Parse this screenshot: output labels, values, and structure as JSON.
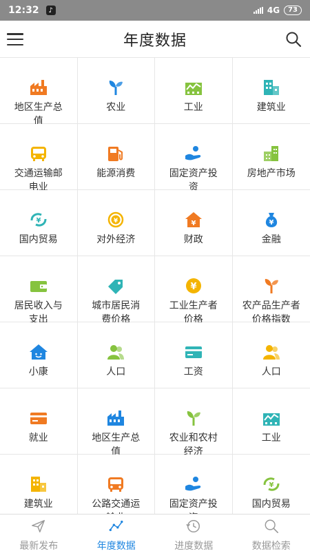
{
  "status": {
    "time": "12:32",
    "network": "4G",
    "battery": "73"
  },
  "header": {
    "title": "年度数据"
  },
  "grid": [
    [
      {
        "label": "地区生产总值",
        "icon": "factory-icon",
        "color": "#f07a22"
      },
      {
        "label": "农业",
        "icon": "sprout-icon",
        "color": "#1f86e0"
      },
      {
        "label": "工业",
        "icon": "industry-icon",
        "color": "#86c33f"
      },
      {
        "label": "建筑业",
        "icon": "building-icon",
        "color": "#2fb4b6"
      }
    ],
    [
      {
        "label": "交通运输邮电业",
        "icon": "bus-icon",
        "color": "#f4b400"
      },
      {
        "label": "能源消费",
        "icon": "fuel-icon",
        "color": "#f07a22"
      },
      {
        "label": "固定资产投资",
        "icon": "hand-coin-icon",
        "color": "#1f86e0"
      },
      {
        "label": "房地产市场",
        "icon": "buildings-icon",
        "color": "#86c33f"
      }
    ],
    [
      {
        "label": "国内贸易",
        "icon": "yen-loop-icon",
        "color": "#2fb4b6"
      },
      {
        "label": "对外经济",
        "icon": "yen-exchange-icon",
        "color": "#f4b400"
      },
      {
        "label": "财政",
        "icon": "yen-house-icon",
        "color": "#f07a22"
      },
      {
        "label": "金融",
        "icon": "money-bag-icon",
        "color": "#1f86e0"
      }
    ],
    [
      {
        "label": "居民收入与支出",
        "icon": "wallet-icon",
        "color": "#86c33f"
      },
      {
        "label": "城市居民消费价格",
        "icon": "price-tag-icon",
        "color": "#2fb4b6"
      },
      {
        "label": "工业生产者价格",
        "icon": "yen-coin-icon",
        "color": "#f4b400"
      },
      {
        "label": "农产品生产者价格指数",
        "icon": "sprout-icon",
        "color": "#f07a22"
      }
    ],
    [
      {
        "label": "小康",
        "icon": "smile-house-icon",
        "color": "#1f86e0"
      },
      {
        "label": "人口",
        "icon": "people-icon",
        "color": "#86c33f"
      },
      {
        "label": "工资",
        "icon": "card-icon",
        "color": "#2fb4b6"
      },
      {
        "label": "人口",
        "icon": "people-icon",
        "color": "#f4b400"
      }
    ],
    [
      {
        "label": "就业",
        "icon": "card-icon",
        "color": "#f07a22"
      },
      {
        "label": "地区生产总值",
        "icon": "factory-icon",
        "color": "#1f86e0"
      },
      {
        "label": "农业和农村经济",
        "icon": "sprout-icon",
        "color": "#86c33f"
      },
      {
        "label": "工业",
        "icon": "industry-icon",
        "color": "#2fb4b6"
      }
    ],
    [
      {
        "label": "建筑业",
        "icon": "building-icon",
        "color": "#f4b400"
      },
      {
        "label": "公路交通运输业",
        "icon": "bus-icon",
        "color": "#f07a22"
      },
      {
        "label": "固定资产投资",
        "icon": "hand-coin-icon",
        "color": "#1f86e0"
      },
      {
        "label": "国内贸易",
        "icon": "yen-loop-icon",
        "color": "#86c33f"
      }
    ]
  ],
  "tabs": [
    {
      "label": "最新发布",
      "icon": "send-icon",
      "active": false
    },
    {
      "label": "年度数据",
      "icon": "trend-icon",
      "active": true
    },
    {
      "label": "进度数据",
      "icon": "history-icon",
      "active": false
    },
    {
      "label": "数据检索",
      "icon": "search-icon",
      "active": false
    }
  ]
}
